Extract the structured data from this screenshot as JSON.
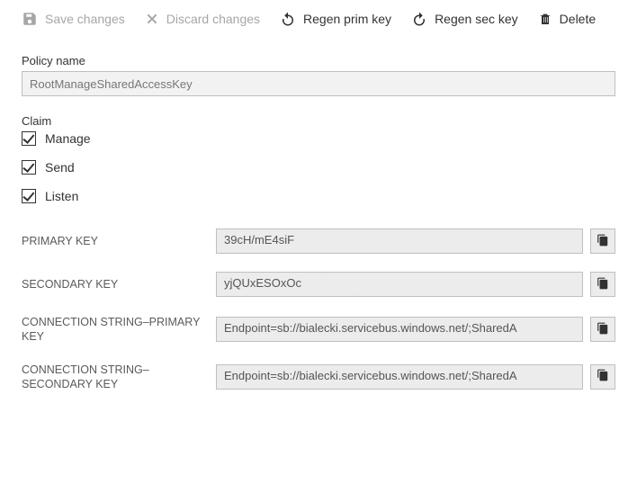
{
  "toolbar": {
    "save": "Save changes",
    "discard": "Discard changes",
    "regen_prim": "Regen prim key",
    "regen_sec": "Regen sec key",
    "delete": "Delete"
  },
  "policy": {
    "label": "Policy name",
    "value": "RootManageSharedAccessKey"
  },
  "claims": {
    "label": "Claim",
    "items": [
      {
        "label": "Manage",
        "checked": true
      },
      {
        "label": "Send",
        "checked": true
      },
      {
        "label": "Listen",
        "checked": true
      }
    ]
  },
  "keys": {
    "primary": {
      "label": "PRIMARY KEY",
      "value": "39cH/mE4siF"
    },
    "secondary": {
      "label": "SECONDARY KEY",
      "value": "yjQUxESOxOc"
    },
    "conn_primary": {
      "label": "CONNECTION STRING–PRIMARY KEY",
      "value": "Endpoint=sb://bialecki.servicebus.windows.net/;SharedA"
    },
    "conn_secondary": {
      "label": "CONNECTION STRING–SECONDARY KEY",
      "value": "Endpoint=sb://bialecki.servicebus.windows.net/;SharedA"
    }
  }
}
